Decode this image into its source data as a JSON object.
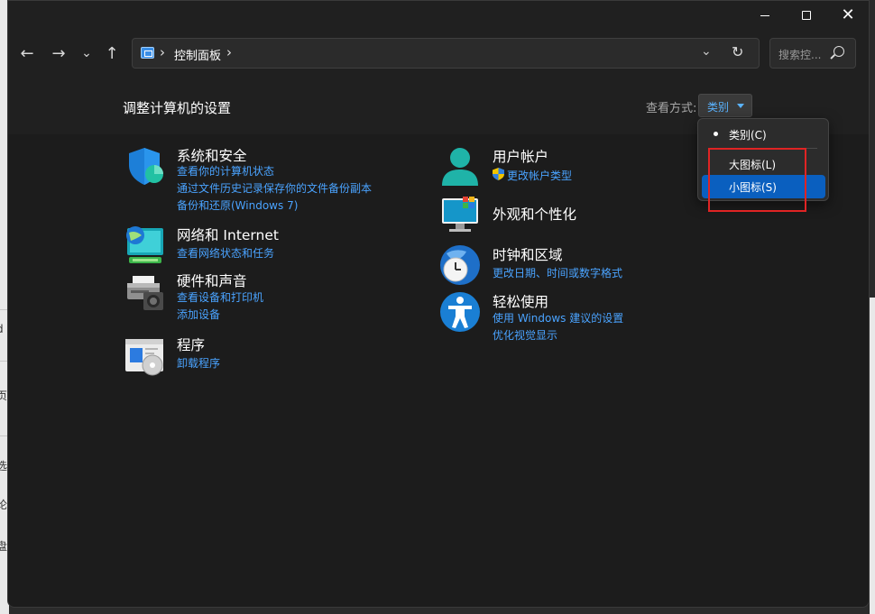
{
  "window": {
    "buttons": {
      "minimize": "—",
      "maximize": "",
      "close": "✕"
    }
  },
  "nav": {
    "back": "←",
    "forward": "→",
    "recent": "⌄",
    "up": "↑",
    "address_icon": "control-panel-icon",
    "address_sep1": "›",
    "address_text": "控制面板",
    "address_sep2": "›",
    "address_dropdown": "⌄",
    "refresh": "↻",
    "search_placeholder": "搜索控..."
  },
  "header": {
    "title": "调整计算机的设置",
    "view_by_label": "查看方式:",
    "view_by_value": "类别"
  },
  "categories": [
    {
      "title": "系统和安全",
      "icon": "shield-icon",
      "links": [
        "查看你的计算机状态",
        "通过文件历史记录保存你的文件备份副本",
        "备份和还原(Windows 7)"
      ]
    },
    {
      "title": "网络和 Internet",
      "icon": "globe-network-icon",
      "links": [
        "查看网络状态和任务"
      ]
    },
    {
      "title": "硬件和声音",
      "icon": "printer-icon",
      "links": [
        "查看设备和打印机",
        "添加设备"
      ]
    },
    {
      "title": "程序",
      "icon": "programs-icon",
      "links": [
        "卸载程序"
      ]
    },
    {
      "title": "用户帐户",
      "icon": "user-icon",
      "links": [
        "更改帐户类型"
      ]
    },
    {
      "title": "外观和个性化",
      "icon": "monitor-icon",
      "links": []
    },
    {
      "title": "时钟和区域",
      "icon": "clock-globe-icon",
      "links": [
        "更改日期、时间或数字格式"
      ]
    },
    {
      "title": "轻松使用",
      "icon": "accessibility-icon",
      "links": [
        "使用 Windows 建议的设置",
        "优化视觉显示"
      ]
    }
  ],
  "view_menu": {
    "items": [
      "类别(C)",
      "大图标(L)",
      "小图标(S)"
    ],
    "checked_index": 0,
    "highlighted_index": 2
  },
  "colors": {
    "link": "#4aa3ff",
    "selected_bg": "#0a5fbf",
    "highlight_box": "#e02424"
  }
}
